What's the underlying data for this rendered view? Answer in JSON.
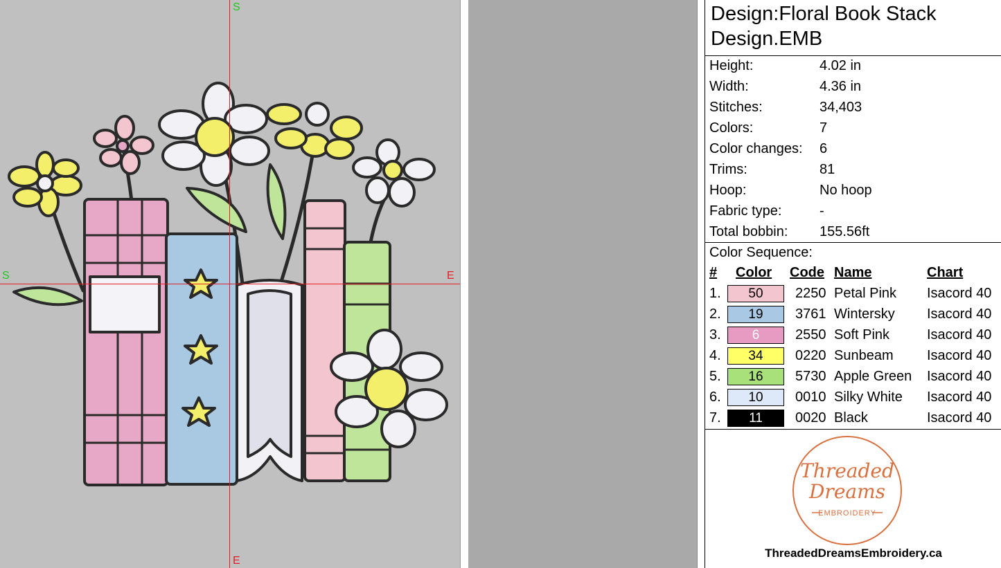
{
  "canvas": {
    "axis_labels": {
      "top": "S",
      "bottom": "E",
      "left": "S",
      "right": "E"
    },
    "colors": {
      "background": "#c0c0c0",
      "crosshair": "#e31b23",
      "start": "#1ec81e",
      "end": "#e31b23"
    }
  },
  "info": {
    "title_line1": "Design:Floral Book Stack",
    "title_line2": "Design.EMB",
    "properties": [
      {
        "label": "Height:",
        "value": "4.02 in"
      },
      {
        "label": "Width:",
        "value": "4.36 in"
      },
      {
        "label": "Stitches:",
        "value": "34,403"
      },
      {
        "label": "Colors:",
        "value": "7"
      },
      {
        "label": "Color changes:",
        "value": "6"
      },
      {
        "label": "Trims:",
        "value": "81"
      },
      {
        "label": "Hoop:",
        "value": "No hoop"
      },
      {
        "label": "Fabric type:",
        "value": "-"
      },
      {
        "label": "Total bobbin:",
        "value": "155.56ft"
      }
    ],
    "sequence_title": "Color Sequence:",
    "headers": {
      "num": "#",
      "color": "Color",
      "code": "Code",
      "name": "Name",
      "chart": "Chart"
    },
    "sequence": [
      {
        "num": "1.",
        "swatch": "50",
        "hex": "#f3c6cf",
        "text": "#000",
        "code": "2250",
        "name": "Petal Pink",
        "chart": "Isacord 40"
      },
      {
        "num": "2.",
        "swatch": "19",
        "hex": "#a8c8e4",
        "text": "#000",
        "code": "3761",
        "name": "Wintersky",
        "chart": "Isacord 40"
      },
      {
        "num": "3.",
        "swatch": "6",
        "hex": "#e79ac2",
        "text": "#fff",
        "code": "2550",
        "name": "Soft Pink",
        "chart": "Isacord 40"
      },
      {
        "num": "4.",
        "swatch": "34",
        "hex": "#ffff66",
        "text": "#000",
        "code": "0220",
        "name": "Sunbeam",
        "chart": "Isacord 40"
      },
      {
        "num": "5.",
        "swatch": "16",
        "hex": "#a8e07a",
        "text": "#000",
        "code": "5730",
        "name": "Apple Green",
        "chart": "Isacord 40"
      },
      {
        "num": "6.",
        "swatch": "10",
        "hex": "#dde8f8",
        "text": "#000",
        "code": "0010",
        "name": "Silky White",
        "chart": "Isacord 40"
      },
      {
        "num": "7.",
        "swatch": "11",
        "hex": "#000000",
        "text": "#fff",
        "code": "0020",
        "name": "Black",
        "chart": "Isacord 40"
      }
    ],
    "logo": {
      "line1": "Threaded",
      "line2": "Dreams",
      "line3": "EMBROIDERY",
      "accent": "#d9703f"
    },
    "website": "ThreadedDreamsEmbroidery.ca"
  }
}
